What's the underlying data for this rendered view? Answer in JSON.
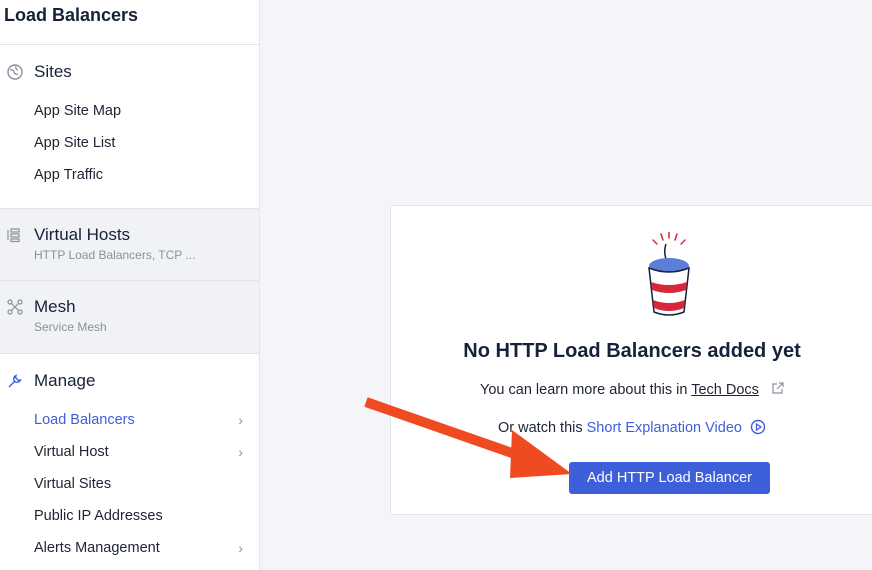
{
  "sidebar": {
    "title": "Load Balancers",
    "sites": {
      "label": "Sites",
      "items": [
        "App Site Map",
        "App Site List",
        "App Traffic"
      ]
    },
    "virtual_hosts": {
      "label": "Virtual Hosts",
      "desc": "HTTP Load Balancers, TCP ..."
    },
    "mesh": {
      "label": "Mesh",
      "desc": "Service Mesh"
    },
    "manage": {
      "label": "Manage",
      "items": [
        {
          "label": "Load Balancers",
          "active": true,
          "chevron": true
        },
        {
          "label": "Virtual Host",
          "active": false,
          "chevron": true
        },
        {
          "label": "Virtual Sites",
          "active": false,
          "chevron": false
        },
        {
          "label": "Public IP Addresses",
          "active": false,
          "chevron": false
        },
        {
          "label": "Alerts Management",
          "active": false,
          "chevron": true
        }
      ]
    }
  },
  "empty_state": {
    "title": "No HTTP Load Balancers added yet",
    "learn_prefix": "You can learn more about this in ",
    "learn_link": "Tech Docs",
    "watch_prefix": "Or watch this ",
    "watch_link": "Short Explanation Video",
    "add_button": "Add HTTP Load Balancer"
  },
  "icons": {
    "sites": "globe-icon",
    "virtual_hosts": "server-stack-icon",
    "mesh": "mesh-network-icon",
    "manage": "wrench-icon",
    "external": "external-link-icon",
    "play": "play-circle-icon"
  },
  "colors": {
    "accent": "#3d5fd9",
    "arrow": "#f04a23"
  }
}
